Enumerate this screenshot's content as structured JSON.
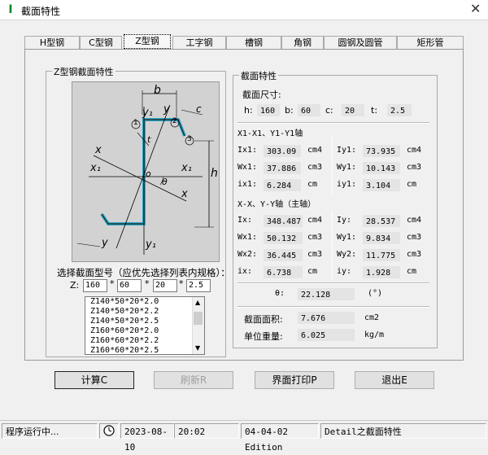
{
  "window": {
    "title": "截面特性",
    "icon": "I",
    "close": "✕"
  },
  "tabs": [
    "H型钢",
    "C型钢",
    "Z型钢",
    "工字钢",
    "槽钢",
    "角钢",
    "圆钢及圆管",
    "矩形管"
  ],
  "left": {
    "group_title": "Z型钢截面特性",
    "diagram_labels": {
      "b": "b",
      "c": "c",
      "t": "t",
      "h": "h",
      "x": "x",
      "y": "y",
      "x1": "x₁",
      "y1": "y₁",
      "o": "o",
      "theta": "θ",
      "n1": "1",
      "n2": "2",
      "n3": "3"
    },
    "select_label": "选择截面型号（应优先选择列表内规格）：",
    "z_label": "Z:",
    "inputs": [
      "160",
      "60",
      "20",
      "2.5"
    ],
    "star": "*",
    "list": [
      "Z140*50*20*2.0",
      "Z140*50*20*2.2",
      "Z140*50*20*2.5",
      "Z160*60*20*2.0",
      "Z160*60*20*2.2",
      "Z160*60*20*2.5"
    ]
  },
  "right": {
    "group_title": "截面特性",
    "dims_title": "截面尺寸:",
    "dims": [
      {
        "k": "h:",
        "v": "160"
      },
      {
        "k": "b:",
        "v": "60"
      },
      {
        "k": "c:",
        "v": "20"
      },
      {
        "k": "t:",
        "v": "2.5"
      }
    ],
    "sec1_title": "X1-X1、Y1-Y1轴",
    "sec1": [
      {
        "k": "Ix1:",
        "v": "303.09",
        "u": "cm4",
        "k2": "Iy1:",
        "v2": "73.935",
        "u2": "cm4"
      },
      {
        "k": "Wx1:",
        "v": "37.886",
        "u": "cm3",
        "k2": "Wy1:",
        "v2": "10.143",
        "u2": "cm3"
      },
      {
        "k": "ix1:",
        "v": "6.284",
        "u": "cm",
        "k2": "iy1:",
        "v2": "3.104",
        "u2": "cm"
      }
    ],
    "sec2_title": "X-X、Y-Y轴（主轴）",
    "sec2": [
      {
        "k": "Ix:",
        "v": "348.487",
        "u": "cm4",
        "k2": "Iy:",
        "v2": "28.537",
        "u2": "cm4"
      },
      {
        "k": "Wx1:",
        "v": "50.132",
        "u": "cm3",
        "k2": "Wy1:",
        "v2": "9.834",
        "u2": "cm3"
      },
      {
        "k": "Wx2:",
        "v": "36.445",
        "u": "cm3",
        "k2": "Wy2:",
        "v2": "11.775",
        "u2": "cm3"
      },
      {
        "k": "ix:",
        "v": "6.738",
        "u": "cm",
        "k2": "iy:",
        "v2": "1.928",
        "u2": "cm"
      }
    ],
    "theta": {
      "k": "θ:",
      "v": "22.128",
      "u": "(°)"
    },
    "area": {
      "k": "截面面积:",
      "v": "7.676",
      "u": "cm2"
    },
    "weight": {
      "k": "单位重量:",
      "v": "6.025",
      "u": "kg/m"
    }
  },
  "buttons": {
    "calc": "计算C",
    "refresh": "刷新R",
    "print": "界面打印P",
    "exit": "退出E"
  },
  "status": {
    "state": "程序运行中...",
    "date": "2023-08-10",
    "time": "20:02",
    "edition": "04-04-02 Edition",
    "detail": "Detail之截面特性"
  }
}
